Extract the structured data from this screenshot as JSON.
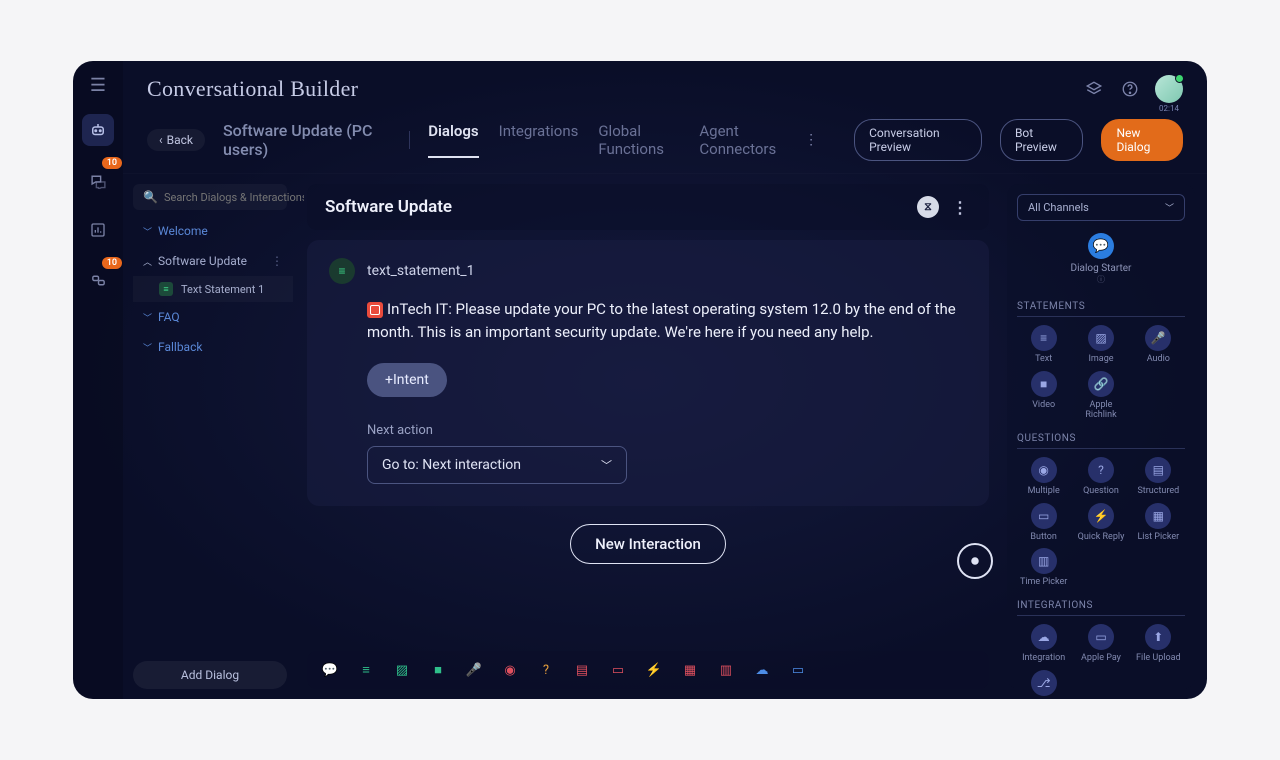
{
  "header": {
    "title": "Conversational Builder",
    "clock": "02:14"
  },
  "sub": {
    "back": "Back",
    "project": "Software Update (PC users)",
    "tabs": [
      "Dialogs",
      "Integrations",
      "Global Functions",
      "Agent Connectors"
    ],
    "active_tab": 0,
    "btn_preview": "Conversation Preview",
    "btn_bot": "Bot Preview",
    "btn_new": "New Dialog"
  },
  "rail": {
    "badge1": "10",
    "badge2": "10"
  },
  "dialogs": {
    "search_placeholder": "Search Dialogs & Interactions",
    "items": [
      {
        "label": "Welcome",
        "expanded": false
      },
      {
        "label": "Software Update",
        "expanded": true,
        "children": [
          {
            "label": "Text Statement 1"
          }
        ]
      },
      {
        "label": "FAQ",
        "expanded": false
      },
      {
        "label": "Fallback",
        "expanded": false
      }
    ],
    "add": "Add Dialog"
  },
  "canvas": {
    "title": "Software Update",
    "stmt_name": "text_statement_1",
    "message": "InTech IT: Please update your PC to the latest operating system 12.0 by the end of the month. This is an important security update. We're here if you need any help.",
    "intent_btn": "+Intent",
    "next_label": "Next action",
    "next_value": "Go to: Next interaction",
    "new_interaction": "New Interaction"
  },
  "palette": {
    "channels": "All Channels",
    "starter": "Dialog Starter",
    "sections": {
      "statements": {
        "title": "STATEMENTS",
        "items": [
          "Text",
          "Image",
          "Audio",
          "Video",
          "Apple Richlink"
        ]
      },
      "questions": {
        "title": "QUESTIONS",
        "items": [
          "Multiple",
          "Question",
          "Structured",
          "Button",
          "Quick Reply",
          "List Picker",
          "Time Picker"
        ]
      },
      "integrations": {
        "title": "INTEGRATIONS",
        "items": [
          "Integration",
          "Apple Pay",
          "File Upload",
          "Dynamic Routing"
        ]
      }
    }
  },
  "tray_icons": [
    "chat",
    "text",
    "image",
    "video",
    "audio",
    "target",
    "question",
    "structured",
    "button",
    "quick",
    "list",
    "time",
    "cloud",
    "card"
  ]
}
